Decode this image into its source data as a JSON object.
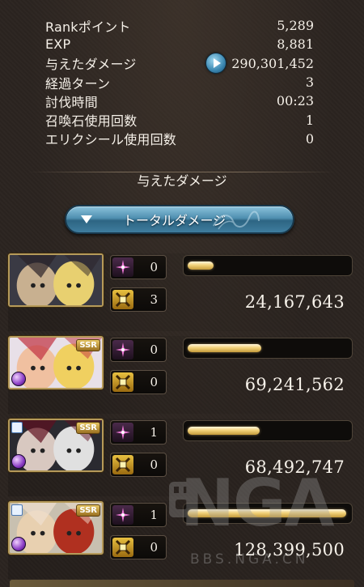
{
  "stats": {
    "rank_points": {
      "label": "Rankポイント",
      "value": "5,289"
    },
    "exp": {
      "label": "EXP",
      "value": "8,881"
    },
    "damage_dealt": {
      "label": "与えたダメージ",
      "value": "290,301,452"
    },
    "turns": {
      "label": "経過ターン",
      "value": "3"
    },
    "time": {
      "label": "討伐時間",
      "value": "00:23"
    },
    "summons_used": {
      "label": "召喚石使用回数",
      "value": "1"
    },
    "elixir_used": {
      "label": "エリクシール使用回数",
      "value": "0"
    }
  },
  "section_title": "与えたダメージ",
  "total_button_label": "トータルダメージ",
  "characters": [
    {
      "portrait": "party-portrait",
      "rarity": "",
      "skills": "0",
      "chains": "3",
      "damage": "24,167,643",
      "bar_fill_pct": 16
    },
    {
      "portrait": "character-portrait",
      "rarity": "SSR",
      "skills": "0",
      "chains": "0",
      "damage": "69,241,562",
      "bar_fill_pct": 46
    },
    {
      "portrait": "character-portrait",
      "rarity": "SSR",
      "skills": "1",
      "chains": "0",
      "damage": "68,492,747",
      "bar_fill_pct": 45
    },
    {
      "portrait": "character-portrait",
      "rarity": "SSR",
      "skills": "1",
      "chains": "0",
      "damage": "128,399,500",
      "bar_fill_pct": 99
    }
  ],
  "watermark": {
    "logo": "NGA",
    "url": "BBS.NGA.CN"
  },
  "colors": {
    "bar_gold": "#f2d27a",
    "button_blue": "#4f8fb0",
    "background": "#2b2420"
  }
}
